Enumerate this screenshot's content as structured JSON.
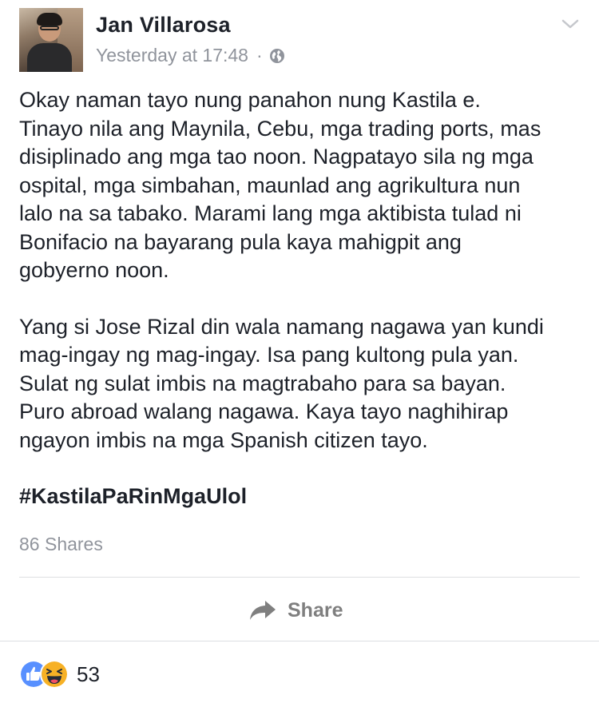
{
  "post": {
    "author": "Jan Villarosa",
    "timestamp": "Yesterday at 17:48",
    "separator": "·",
    "privacy_icon": "globe-icon",
    "paragraph_1": "Okay naman tayo nung panahon nung Kastila e.\nTinayo nila ang Maynila, Cebu, mga trading ports, mas\ndisiplinado ang mga tao noon. Nagpatayo sila ng mga\nospital, mga simbahan, maunlad ang agrikultura nun\nlalo na sa tabako. Marami lang mga aktibista tulad ni\nBonifacio na bayarang pula kaya mahigpit ang\ngobyerno noon.",
    "paragraph_2": "Yang si Jose Rizal din wala namang nagawa yan kundi\nmag-ingay ng mag-ingay. Isa pang kultong pula yan.\nSulat ng sulat imbis na magtrabaho para sa bayan.\nPuro abroad walang nagawa. Kaya tayo naghihirap\nngayon imbis na mga Spanish citizen tayo.",
    "hashtag": "#KastilaPaRinMgaUlol",
    "shares": "86 Shares"
  },
  "actions": {
    "share_label": "Share",
    "share_icon": "share-arrow-icon"
  },
  "reactions": {
    "icons": [
      "like-icon",
      "haha-icon"
    ],
    "count": "53",
    "like_color": "#5890ff",
    "haha_color": "#f7b125"
  },
  "colors": {
    "text": "#1d2129",
    "secondary_text": "#90949c",
    "divider": "#dddfe2"
  }
}
